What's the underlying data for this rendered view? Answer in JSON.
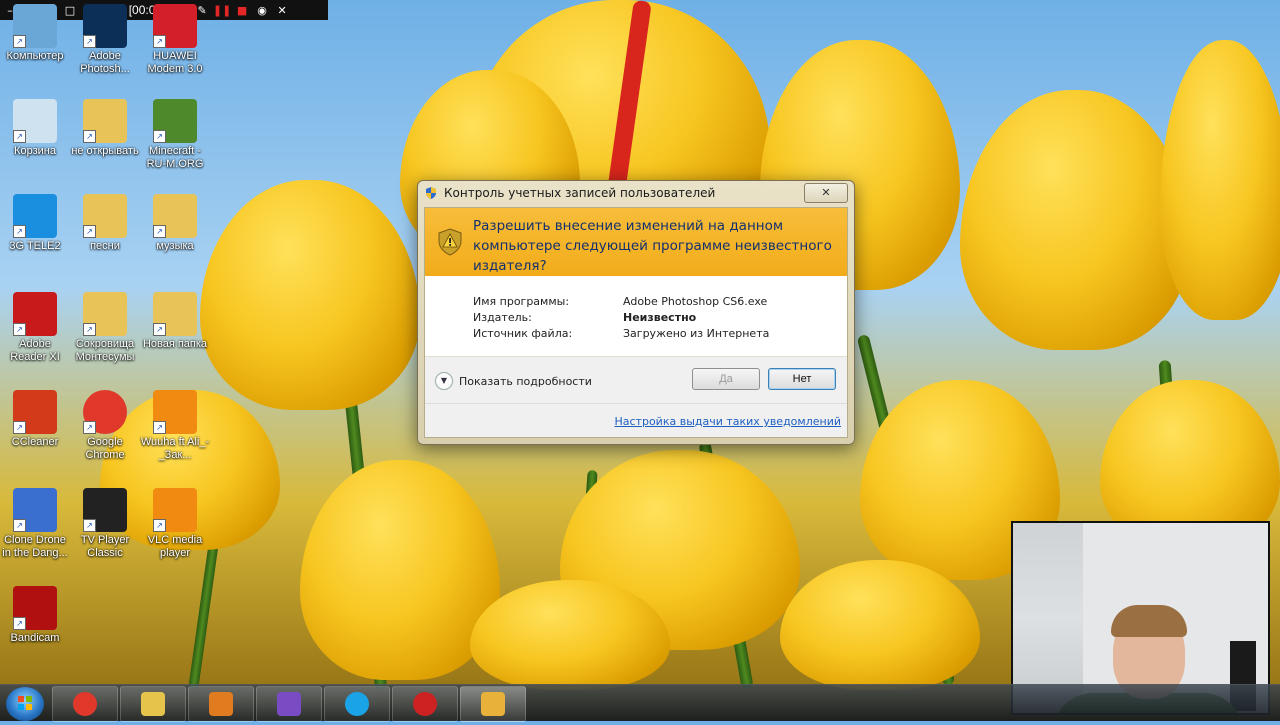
{
  "recorder": {
    "title": "Запись [00:00:58]"
  },
  "desktop_icons": [
    {
      "label": "Компьютер",
      "icon": "computer-icon"
    },
    {
      "label": "Adobe Photosh...",
      "icon": "photoshop-icon"
    },
    {
      "label": "HUAWEI Modem 3.0",
      "icon": "huawei-icon"
    },
    {
      "label": "Корзина",
      "icon": "recycle-bin-icon"
    },
    {
      "label": "не открывать",
      "icon": "folder-icon"
    },
    {
      "label": "Minecraft - RU-M.ORG",
      "icon": "minecraft-icon"
    },
    {
      "label": "3G TELE2",
      "icon": "3g-icon"
    },
    {
      "label": "песни",
      "icon": "folder-icon"
    },
    {
      "label": "музыка",
      "icon": "folder-icon"
    },
    {
      "label": "Adobe Reader XI",
      "icon": "adobe-reader-icon"
    },
    {
      "label": "Сокровища Монтесумы",
      "icon": "folder-icon"
    },
    {
      "label": "Новая папка",
      "icon": "folder-icon"
    },
    {
      "label": "CCleaner",
      "icon": "ccleaner-icon"
    },
    {
      "label": "Google Chrome",
      "icon": "chrome-icon"
    },
    {
      "label": "Wuuha ft Ali_-_Зак...",
      "icon": "vlc-icon"
    },
    {
      "label": "Clone Drone in the Dang...",
      "icon": "clone-drone-icon"
    },
    {
      "label": "TV Player Classic",
      "icon": "tv-player-icon"
    },
    {
      "label": "VLC media player",
      "icon": "vlc-icon"
    },
    {
      "label": "Bandicam",
      "icon": "bandicam-icon"
    }
  ],
  "uac": {
    "title": "Контроль учетных записей пользователей",
    "close_label": "✕",
    "question": "Разрешить внесение изменений на данном компьютере следующей программе неизвестного издателя?",
    "info": [
      {
        "key": "Имя программы:",
        "value": "Adobe Photoshop CS6.exe"
      },
      {
        "key": "Издатель:",
        "value": "Неизвестно"
      },
      {
        "key": "Источник файла:",
        "value": "Загружено из Интернета"
      }
    ],
    "details_label": "Показать подробности",
    "yes_label": "Да",
    "no_label": "Нет",
    "settings_link": "Настройка выдачи таких уведомлений",
    "banner_color": "#f2ac1a"
  },
  "taskbar": {
    "items": [
      {
        "icon": "chrome-icon",
        "color": "#e0392b"
      },
      {
        "icon": "file-explorer-icon",
        "color": "#e6c34a"
      },
      {
        "icon": "media-player-icon",
        "color": "#e07b1f"
      },
      {
        "icon": "visual-studio-icon",
        "color": "#7a4cc4"
      },
      {
        "icon": "skype-icon",
        "color": "#1aa3e6"
      },
      {
        "icon": "bandicam-icon",
        "color": "#c22"
      },
      {
        "icon": "uac-shield-icon",
        "color": "#e8b23a"
      }
    ]
  }
}
